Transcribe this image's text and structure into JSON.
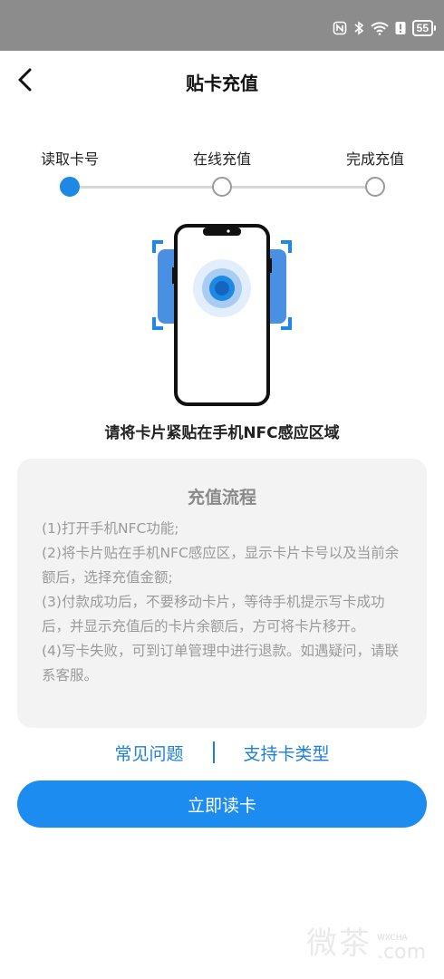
{
  "status_bar": {
    "icons": [
      "nfc-icon",
      "bluetooth-icon",
      "wifi-icon",
      "alert-icon"
    ],
    "battery_level": "55"
  },
  "header": {
    "back_icon": "chevron-left-icon",
    "title": "贴卡充值"
  },
  "stepper": {
    "steps": [
      {
        "label": "读取卡号",
        "active": true
      },
      {
        "label": "在线充值",
        "active": false
      },
      {
        "label": "完成充值",
        "active": false
      }
    ]
  },
  "illustration": {
    "icon": "phone-nfc-icon",
    "accent_color": "#1e88e5"
  },
  "instruction": "请将卡片紧贴在手机NFC感应区域",
  "process": {
    "title": "充值流程",
    "items": [
      "(1)打开手机NFC功能;",
      "(2)将卡片贴在手机NFC感应区，显示卡片卡号以及当前余额后，选择充值金额;",
      "(3)付款成功后，不要移动卡片，等待手机提示写卡成功后，并显示充值后的卡片余额后，方可将卡片移开。",
      "(4)写卡失败，可到订单管理中进行退款。如遇疑问，请联系客服。"
    ]
  },
  "links": {
    "faq": "常见问题",
    "card_types": "支持卡类型"
  },
  "primary_button": {
    "label": "立即读卡",
    "color": "#1c8cf0"
  },
  "watermark": {
    "main": "微茶",
    "small_top": "WXCHA",
    "small_bottom": ".com"
  }
}
